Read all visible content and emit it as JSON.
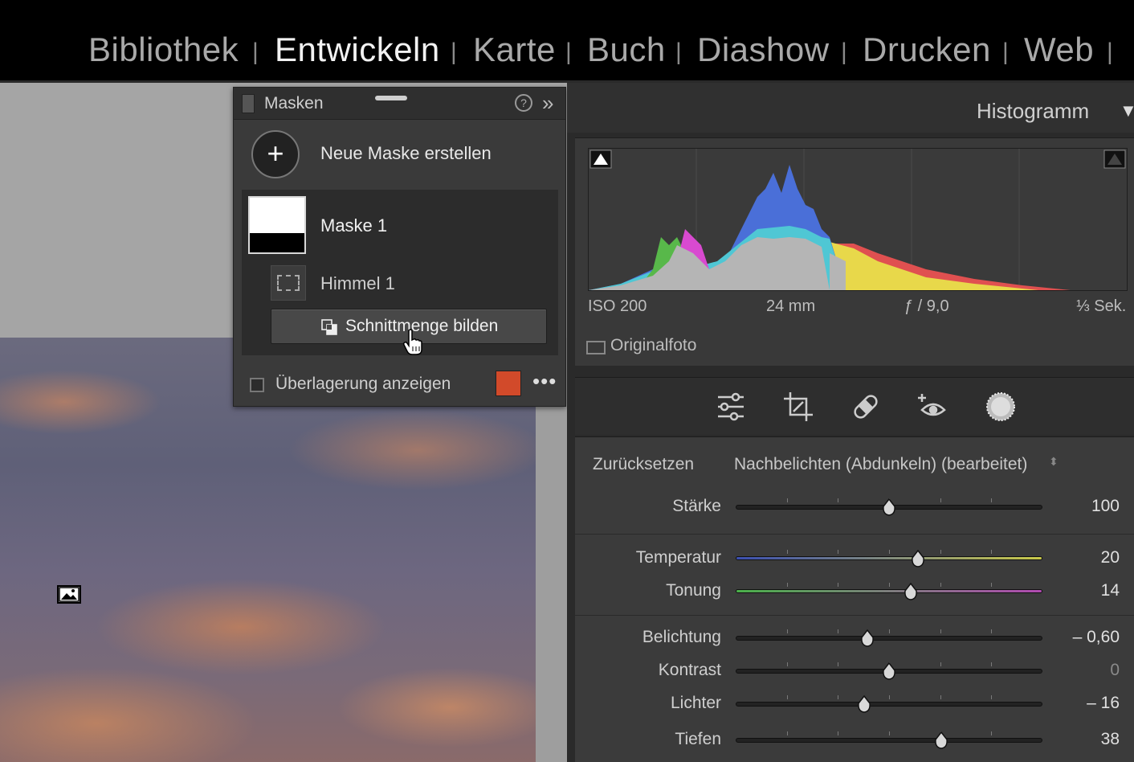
{
  "modules": {
    "items": [
      {
        "label": "Bibliothek"
      },
      {
        "label": "Entwickeln"
      },
      {
        "label": "Karte"
      },
      {
        "label": "Buch"
      },
      {
        "label": "Diashow"
      },
      {
        "label": "Drucken"
      },
      {
        "label": "Web"
      }
    ],
    "separator": "|",
    "active": "Entwickeln"
  },
  "masks_panel": {
    "title": "Masken",
    "help_symbol": "?",
    "collapse_symbol": "»",
    "new_mask_symbol": "+",
    "new_mask_label": "Neue Maske erstellen",
    "mask_name": "Maske 1",
    "component_name": "Himmel 1",
    "intersect_button": "Schnittmenge bilden",
    "overlay_label": "Überlagerung anzeigen",
    "overlay_color": "#d24a2a",
    "more_symbol": "•••"
  },
  "histogram": {
    "title": "Histogramm",
    "iso": "ISO 200",
    "focal": "24 mm",
    "aperture": "ƒ / 9,0",
    "shutter": "⅓ Sek.",
    "original_label": "Originalfoto"
  },
  "tools": [
    "sliders-icon",
    "crop-icon",
    "heal-icon",
    "redeye-icon",
    "mask-icon"
  ],
  "adjustments": {
    "reset": "Zurücksetzen",
    "preset": "Nachbelichten (Abdunkeln) (bearbeitet)",
    "preset_arrows": "⬍",
    "sliders": [
      {
        "label": "Stärke",
        "value": "100",
        "pos": 0.5
      },
      {
        "label": "Temperatur",
        "value": "20",
        "pos": 0.595
      },
      {
        "label": "Tonung",
        "value": "14",
        "pos": 0.57
      },
      {
        "label": "Belichtung",
        "value": "– 0,60",
        "pos": 0.43
      },
      {
        "label": "Kontrast",
        "value": "0",
        "pos": 0.5
      },
      {
        "label": "Lichter",
        "value": "– 16",
        "pos": 0.42
      },
      {
        "label": "Tiefen",
        "value": "38",
        "pos": 0.67
      }
    ]
  }
}
